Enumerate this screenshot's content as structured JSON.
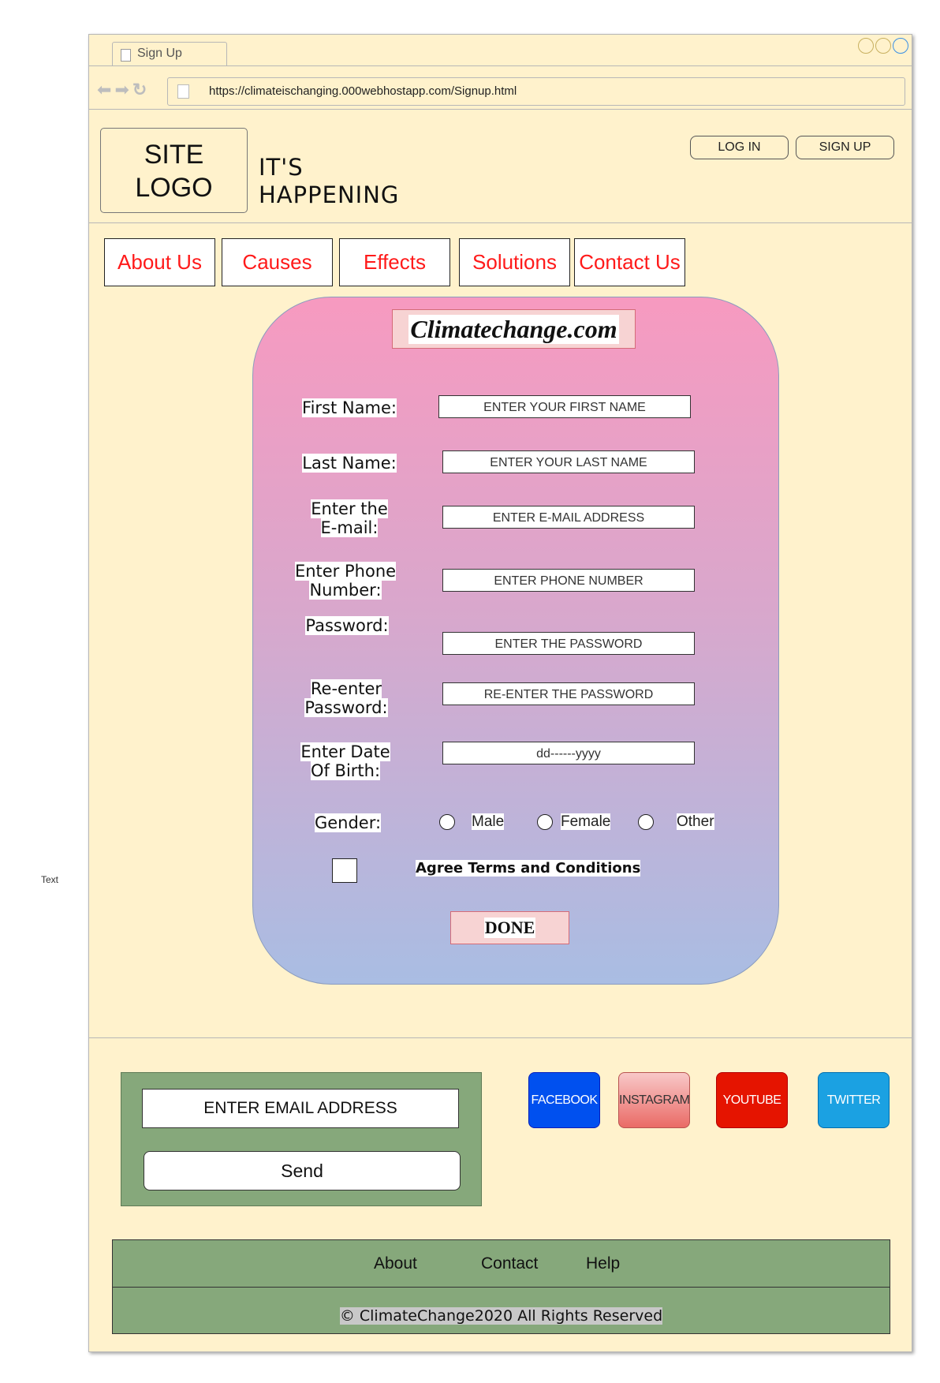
{
  "side_text": "Text",
  "browser": {
    "tab_title": "Sign Up",
    "url": "https://climateischanging.000webhostapp.com/Signup.html"
  },
  "header": {
    "logo_line1": "SITE",
    "logo_line2": "LOGO",
    "tagline_line1": "IT'S",
    "tagline_line2": "HAPPENING",
    "login": "LOG IN",
    "signup": "SIGN UP"
  },
  "nav": {
    "about": "About Us",
    "causes": "Causes",
    "effects": "Effects",
    "solutions": "Solutions",
    "contact": "Contact Us"
  },
  "form": {
    "title": "Climatechange.com",
    "first_name_label": "First Name:",
    "first_name_placeholder": "ENTER YOUR FIRST NAME",
    "last_name_label": "Last Name:",
    "last_name_placeholder": "ENTER YOUR LAST NAME",
    "email_label_1": "Enter the",
    "email_label_2": "E-mail:",
    "email_placeholder": "ENTER E-MAIL ADDRESS",
    "phone_label_1": "Enter Phone",
    "phone_label_2": "Number:",
    "phone_placeholder": "ENTER PHONE NUMBER",
    "password_label": "Password:",
    "password_placeholder": "ENTER THE PASSWORD",
    "repassword_label_1": "Re-enter",
    "repassword_label_2": "Password:",
    "repassword_placeholder": "RE-ENTER THE PASSWORD",
    "dob_label_1": "Enter Date",
    "dob_label_2": "Of Birth:",
    "dob_placeholder": "dd------yyyy",
    "gender_label": "Gender:",
    "gender_male": "Male",
    "gender_female": "Female",
    "gender_other": "Other",
    "agree_label": "Agree Terms and Conditions",
    "submit": "DONE"
  },
  "newsletter": {
    "email_placeholder": "ENTER EMAIL ADDRESS",
    "send": "Send"
  },
  "social": {
    "facebook": "FACEBOOK",
    "instagram": "INSTAGRAM",
    "youtube": "YOUTUBE",
    "twitter": "TWITTER"
  },
  "footer": {
    "about": "About",
    "contact": "Contact",
    "help": "Help",
    "copyright": "© ClimateChange2020 All Rights Reserved"
  },
  "colors": {
    "window_bg": "#fff2cc",
    "nav_text": "#ff1a1a",
    "footer_green": "#86a87b",
    "facebook": "#0050ef",
    "instagram": "#f08080",
    "youtube": "#e51400",
    "twitter": "#1ba1e2"
  }
}
